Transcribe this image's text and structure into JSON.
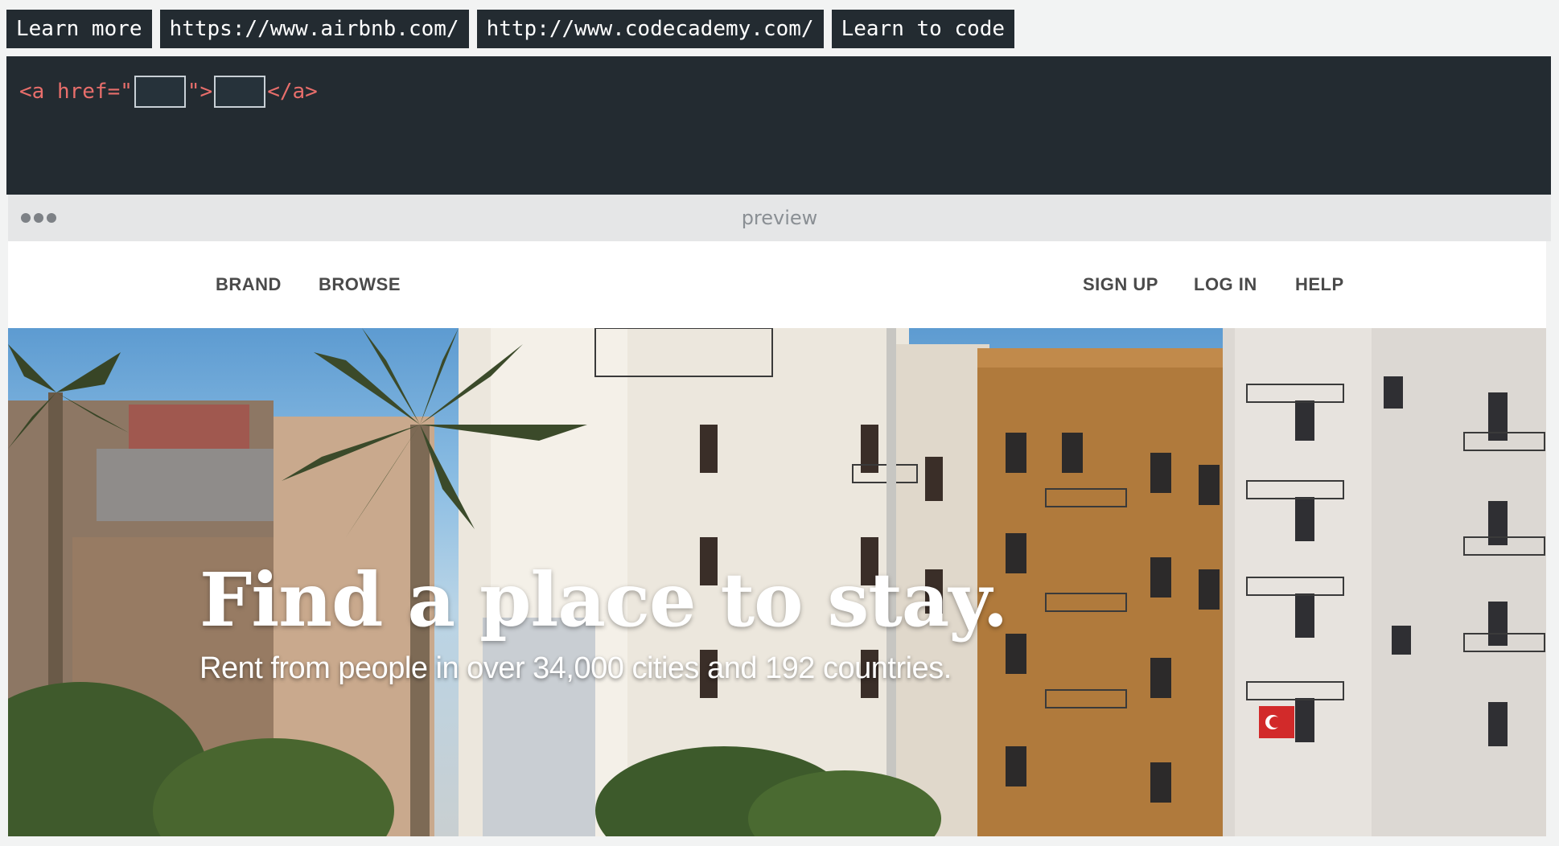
{
  "answer_chips": [
    {
      "label": "Learn more"
    },
    {
      "label": "https://www.airbnb.com/"
    },
    {
      "label": "http://www.codecademy.com/"
    },
    {
      "label": "Learn to code"
    }
  ],
  "editor": {
    "open_tag": "<a",
    "attribute": " href",
    "equals": "=",
    "open_quote": "\"",
    "close_quote_bracket": "\">",
    "close_tag": "</a>",
    "href_slot_value": "",
    "text_slot_value": ""
  },
  "preview_bar": {
    "label": "preview"
  },
  "site": {
    "nav_left": [
      {
        "label": "BRAND"
      },
      {
        "label": "BROWSE"
      }
    ],
    "nav_right": [
      {
        "label": "SIGN UP"
      },
      {
        "label": "LOG IN"
      },
      {
        "label": "HELP"
      }
    ],
    "hero": {
      "title": "Find a place to stay.",
      "subtitle": "Rent from people in over 34,000 cities and 192 countries."
    }
  },
  "colors": {
    "editor_bg": "#232b31",
    "code_token": "#e86e6b",
    "preview_bar_bg": "#e5e6e7",
    "nav_text": "#4a4a4a"
  }
}
